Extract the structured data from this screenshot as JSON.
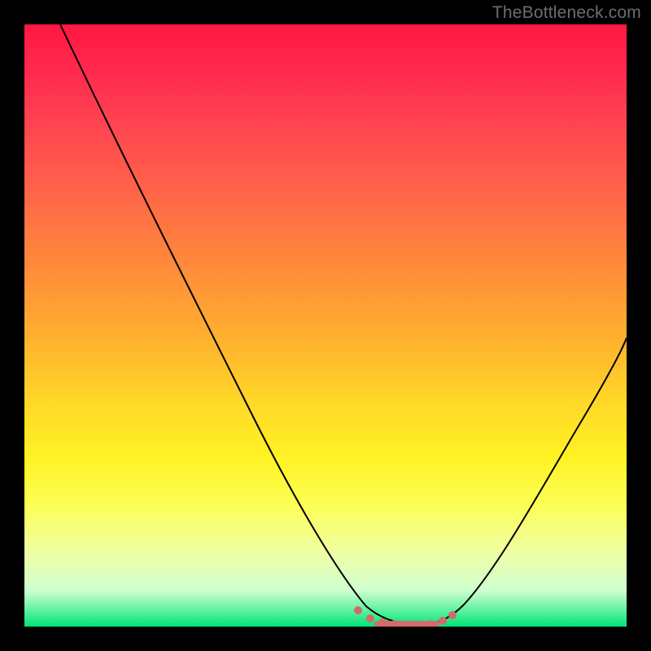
{
  "watermark": "TheBottleneck.com",
  "chart_data": {
    "type": "line",
    "title": "",
    "xlabel": "",
    "ylabel": "",
    "xlim": [
      0,
      100
    ],
    "ylim": [
      0,
      100
    ],
    "series": [
      {
        "name": "curve",
        "x": [
          0,
          10,
          20,
          30,
          40,
          50,
          55,
          60,
          63,
          66,
          70,
          75,
          80,
          85,
          90,
          95,
          100
        ],
        "values": [
          100,
          85,
          70,
          55,
          40,
          25,
          15,
          7,
          2,
          1,
          1,
          3,
          7,
          15,
          25,
          36,
          48
        ]
      },
      {
        "name": "minimum-marker-dots",
        "x": [
          55,
          57,
          59,
          61,
          63,
          65,
          67,
          69
        ],
        "values": [
          1.5,
          1.2,
          1.0,
          1.0,
          1.0,
          1.0,
          1.2,
          1.5
        ]
      }
    ],
    "annotations": [],
    "background": "vertical-gradient red→yellow→green",
    "frame": "black"
  }
}
